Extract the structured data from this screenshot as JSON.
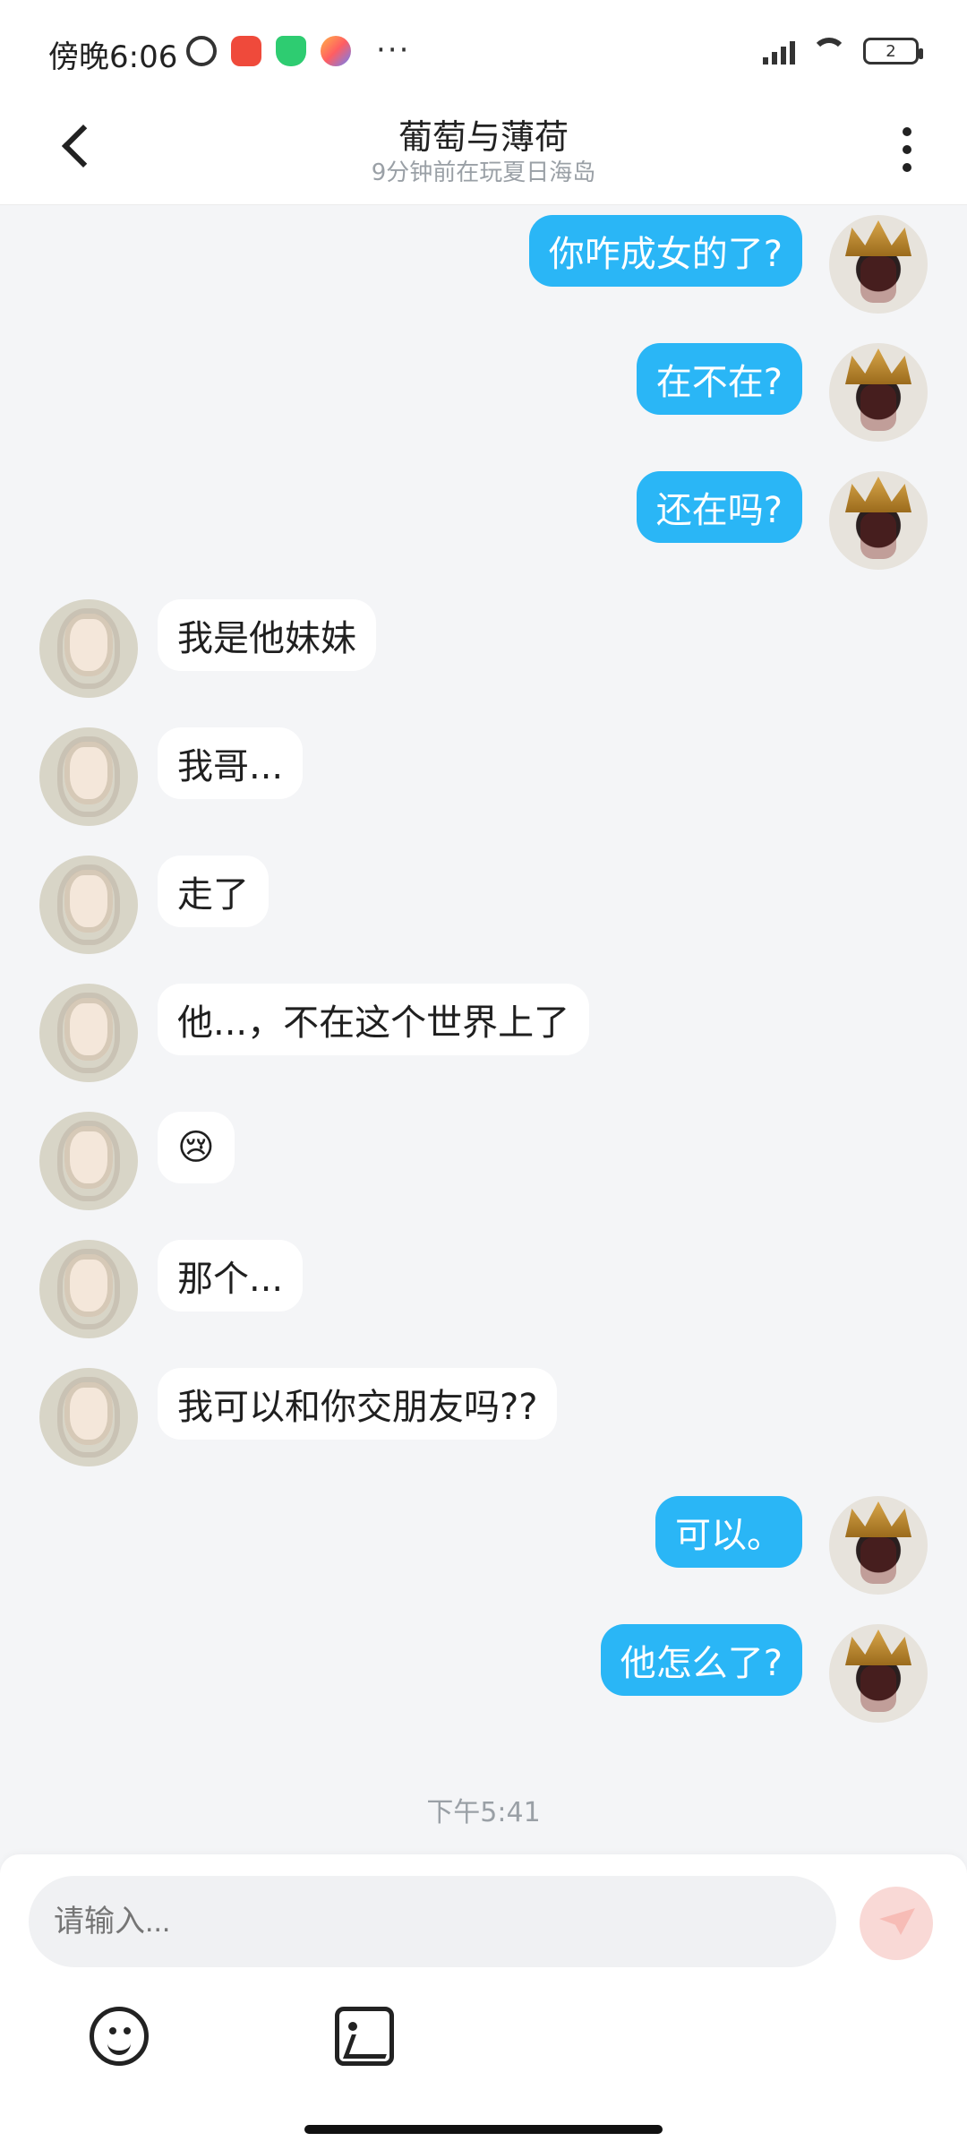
{
  "status_bar": {
    "time": "傍晚6:06",
    "more": "···",
    "battery_level": "2",
    "icons": [
      "alarm-icon",
      "notification-app-icon",
      "security-shield-icon",
      "game-center-icon",
      "signal-hd-icon",
      "wifi-icon",
      "battery-icon"
    ]
  },
  "header": {
    "title": "葡萄与薄荷",
    "subtitle": "9分钟前在玩夏日海岛",
    "back_icon": "chevron-left-icon",
    "menu_icon": "kebab-menu-icon"
  },
  "messages": [
    {
      "side": "right",
      "text": "你咋成女的了?"
    },
    {
      "side": "right",
      "text": "在不在?"
    },
    {
      "side": "right",
      "text": "还在吗?"
    },
    {
      "side": "left",
      "text": "我是他妹妹"
    },
    {
      "side": "left",
      "text": "我哥..."
    },
    {
      "side": "left",
      "text": "走了"
    },
    {
      "side": "left",
      "text": "他...，不在这个世界上了"
    },
    {
      "side": "left",
      "text": "😢"
    },
    {
      "side": "left",
      "text": "那个..."
    },
    {
      "side": "left",
      "text": "我可以和你交朋友吗??"
    },
    {
      "side": "right",
      "text": "可以。"
    },
    {
      "side": "right",
      "text": "他怎么了?"
    }
  ],
  "timestamp": "下午5:41",
  "composer": {
    "placeholder": "请输入...",
    "send_icon": "send-icon",
    "emoji_icon": "emoji-icon",
    "image_icon": "image-icon"
  },
  "colors": {
    "outgoing_bubble": "#2ab6f6",
    "incoming_bubble": "#ffffff",
    "chat_background": "#f4f5f7"
  }
}
